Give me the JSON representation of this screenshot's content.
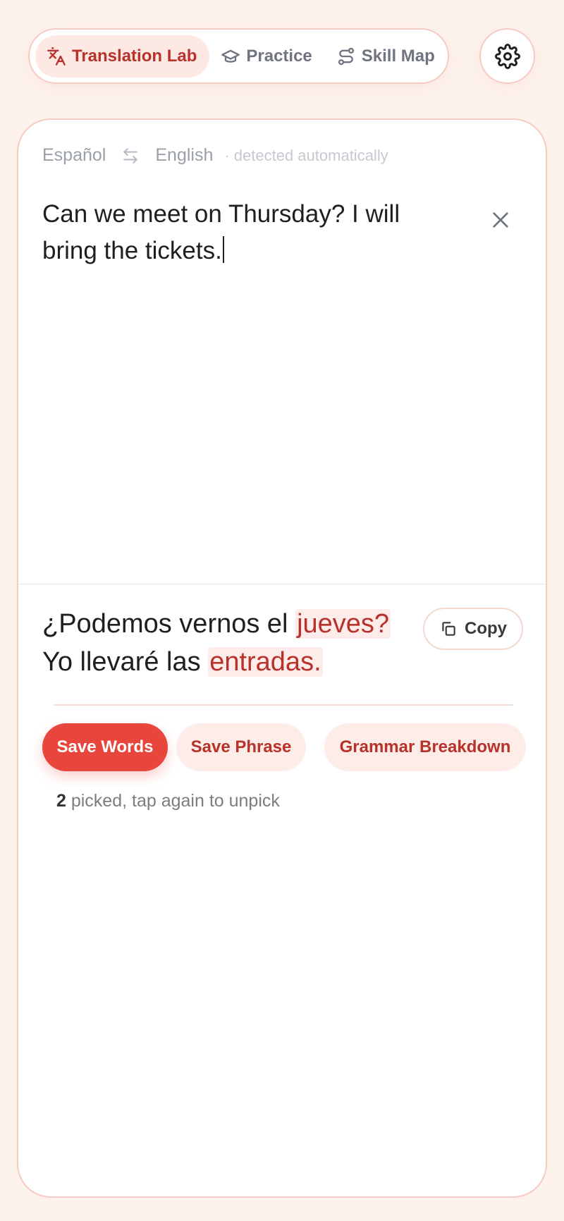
{
  "nav": {
    "tabs": [
      {
        "label": "Translation Lab",
        "icon": "translate-icon",
        "active": true
      },
      {
        "label": "Practice",
        "icon": "graduation-cap-icon",
        "active": false
      },
      {
        "label": "Skill Map",
        "icon": "route-icon",
        "active": false
      }
    ],
    "settings_icon": "gear-icon"
  },
  "translator": {
    "source_lang": "Español",
    "target_lang": "English",
    "detected_note": "· detected automatically",
    "input_text": "Can we meet on Thursday? I will bring the tickets.",
    "output": {
      "line1_plain": "¿Podemos vernos el ",
      "line1_highlight": "jueves?",
      "line2_plain": "Yo llevaré las ",
      "line2_highlight": "entradas."
    },
    "copy_label": "Copy"
  },
  "actions": {
    "save_words": "Save Words",
    "save_phrase": "Save Phrase",
    "grammar": "Grammar Breakdown"
  },
  "picked": {
    "count": "2",
    "text": " picked, tap again to unpick"
  },
  "colors": {
    "accent": "#e8463d",
    "accent_dark": "#b7322b",
    "background": "#fdf2ec",
    "highlight_bg": "#fdecea"
  }
}
